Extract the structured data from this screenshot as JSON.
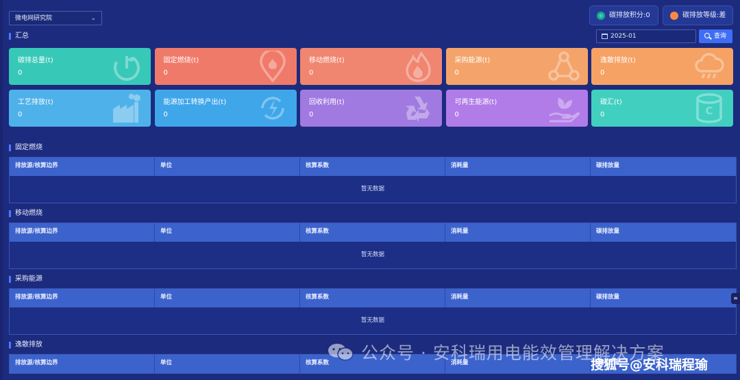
{
  "header": {
    "org_select": "微电网研究院",
    "score_badge": "碳排放积分:0",
    "level_badge": "碳排放等级:差"
  },
  "summary": {
    "title": "汇总",
    "date_value": "2025-01",
    "query_label": "查询"
  },
  "cards": [
    {
      "label": "碳排总量(t)",
      "value": "0",
      "icon": "power-sprout-icon"
    },
    {
      "label": "固定燃烧(t)",
      "value": "0",
      "icon": "location-flame-icon"
    },
    {
      "label": "移动燃烧(t)",
      "value": "0",
      "icon": "flame-icon"
    },
    {
      "label": "采购能源(t)",
      "value": "0",
      "icon": "network-cycle-icon"
    },
    {
      "label": "逸散排放(t)",
      "value": "0",
      "icon": "cloud-rain-icon"
    },
    {
      "label": "工艺排放(t)",
      "value": "0",
      "icon": "factory-icon"
    },
    {
      "label": "能源加工转换产出(t)",
      "value": "0",
      "icon": "energy-conversion-icon"
    },
    {
      "label": "回收利用(t)",
      "value": "0",
      "icon": "recycle-icon"
    },
    {
      "label": "可再生能源(t)",
      "value": "0",
      "icon": "hand-leaf-icon"
    },
    {
      "label": "碳汇(t)",
      "value": "0",
      "icon": "carbon-storage-icon"
    }
  ],
  "card_colors": [
    "#37c8b8",
    "#f07a6a",
    "#f08570",
    "#f4a46a",
    "#f5a264",
    "#4fb1ea",
    "#3fa6ea",
    "#a07ae0",
    "#b17ce8",
    "#41cfc0"
  ],
  "columns": [
    "排放源/核算边界",
    "单位",
    "核算系数",
    "消耗量",
    "碳排放量"
  ],
  "tables": [
    {
      "title": "固定燃烧",
      "empty": "暂无数据"
    },
    {
      "title": "移动燃烧",
      "empty": "暂无数据"
    },
    {
      "title": "采购能源",
      "empty": "暂无数据"
    },
    {
      "title": "逸散排放",
      "empty": ""
    }
  ],
  "side_handle": "≡",
  "watermark": {
    "text": "公众号 · 安科瑞用电能效管理解决方案",
    "right_text": "搜狐号@安科瑞程瑜"
  }
}
